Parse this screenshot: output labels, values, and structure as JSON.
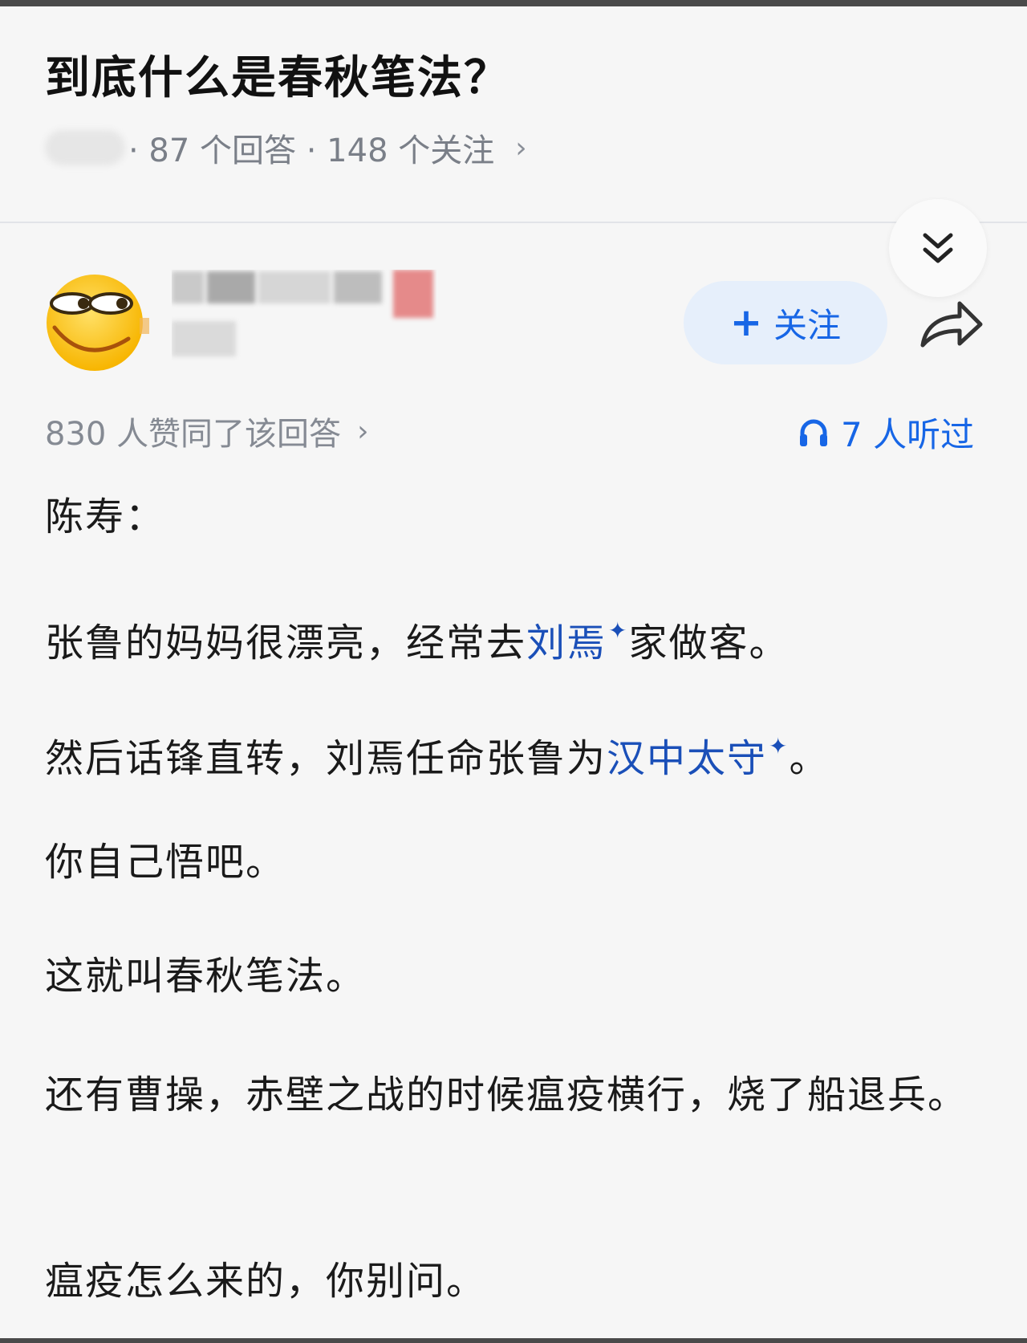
{
  "question": {
    "title": "到底什么是春秋笔法？",
    "meta_answers": "· 87 个回答 · 148 个关注",
    "meta_chevron": "›"
  },
  "author": {
    "follow_label": "关注",
    "follow_icon": "plus-icon",
    "share_icon": "share-arrow-icon",
    "collapse_icon": "double-chevron-down-icon",
    "avatar_icon": "smirk-emoji-avatar"
  },
  "stats": {
    "votes": "830 人赞同了该回答",
    "votes_chevron": "›",
    "listened": "7 人听过",
    "listened_icon": "headphones-icon"
  },
  "answer": {
    "p1": "陈寿：",
    "p2_a": "张鲁的妈妈很漂亮，经常去",
    "p2_link": "刘焉",
    "p2_b": "家做客。",
    "p3_a": "然后话锋直转，刘焉任命张鲁为",
    "p3_link": "汉中太守",
    "p3_b": "。",
    "p4": "你自己悟吧。",
    "p5": "这就叫春秋笔法。",
    "p6": "还有曹操，赤壁之战的时候瘟疫横行，烧了船退兵。",
    "p7": "瘟疫怎么来的，你别问。",
    "sparkle": "✦"
  },
  "colors": {
    "link": "#1a4fb8",
    "accent": "#1766e6",
    "follow_bg": "#e6effb",
    "meta_gray": "#7a7f88"
  }
}
